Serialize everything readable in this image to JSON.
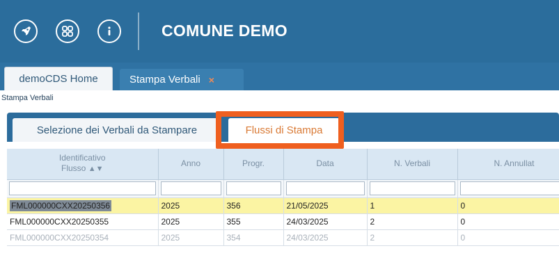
{
  "header": {
    "title": "COMUNE DEMO",
    "icons": [
      "rocket-icon",
      "apps-grid-icon",
      "info-icon"
    ],
    "color": "#2b6d9c"
  },
  "tabs": [
    {
      "label": "demoCDS Home",
      "active": false
    },
    {
      "label": "Stampa Verbali",
      "active": true,
      "close": "×"
    }
  ],
  "breadcrumb": "Stampa Verbali",
  "subtabs": [
    {
      "label": "Selezione dei Verbali da Stampare",
      "active": false
    },
    {
      "label": "Flussi di Stampa",
      "active": true
    }
  ],
  "highlight_color": "#ef5f1f",
  "grid": {
    "columns": [
      {
        "line1": "Identificativo",
        "line2": "Flusso",
        "sort": "▲▼"
      },
      {
        "line1": "Anno"
      },
      {
        "line1": "Progr."
      },
      {
        "line1": "Data"
      },
      {
        "line1": "N. Verbali"
      },
      {
        "line1": "N. Annullat"
      }
    ],
    "rows": [
      [
        "FML000000CXX20250356",
        "2025",
        "356",
        "21/05/2025",
        "1",
        "0"
      ],
      [
        "FML000000CXX20250355",
        "2025",
        "355",
        "24/03/2025",
        "2",
        "0"
      ],
      [
        "FML000000CXX20250354",
        "2025",
        "354",
        "24/03/2025",
        "2",
        "0"
      ]
    ],
    "selected_row": 0
  }
}
